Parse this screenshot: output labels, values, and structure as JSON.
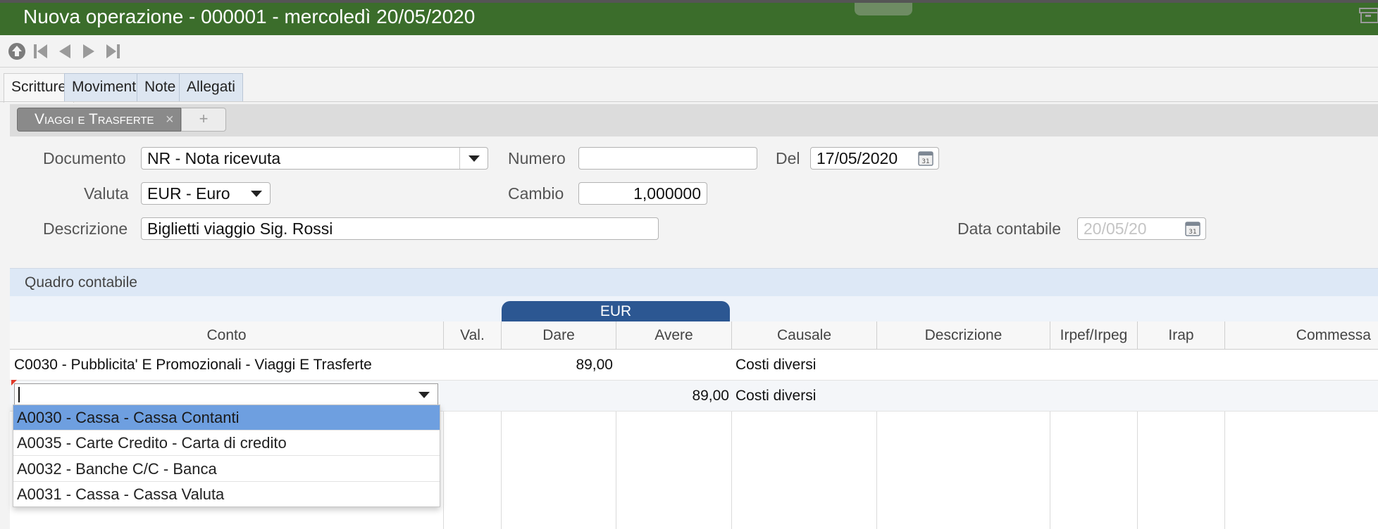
{
  "window": {
    "title": "Nuova operazione - 000001 - mercoledì 20/05/2020"
  },
  "toolbar": {
    "buttons": [
      "upload-icon",
      "first-record-icon",
      "previous-record-icon",
      "next-record-icon",
      "last-record-icon"
    ],
    "right_icon": "archive-icon"
  },
  "tabs": [
    {
      "label": "Scritture",
      "active": true
    },
    {
      "label": "Movimenti",
      "active": false
    },
    {
      "label": "Note",
      "active": false
    },
    {
      "label": "Allegati",
      "active": false
    }
  ],
  "subtabs": {
    "active_label": "Viaggi e Trasferte",
    "close_glyph": "×",
    "add_glyph": "+"
  },
  "form": {
    "documento": {
      "label": "Documento",
      "value": "NR - Nota ricevuta"
    },
    "numero": {
      "label": "Numero",
      "value": ""
    },
    "del": {
      "label": "Del",
      "value": "17/05/2020"
    },
    "valuta": {
      "label": "Valuta",
      "value": "EUR - Euro"
    },
    "cambio": {
      "label": "Cambio",
      "value": "1,000000"
    },
    "descrizione": {
      "label": "Descrizione",
      "value": "Biglietti viaggio Sig. Rossi"
    },
    "data_contabile": {
      "label": "Data contabile",
      "placeholder": "20/05/20"
    }
  },
  "quadro": {
    "title": "Quadro contabile",
    "currency_group": "EUR",
    "columns": [
      "Conto",
      "Val.",
      "Dare",
      "Avere",
      "Causale",
      "Descrizione",
      "Irpef/Irpeg",
      "Irap",
      "Commessa"
    ],
    "rows": [
      {
        "conto": "C0030 - Pubblicita' E Promozionali - Viaggi E Trasferte",
        "val": "",
        "dare": "89,00",
        "avere": "",
        "causale": "Costi diversi"
      },
      {
        "conto": "",
        "val": "",
        "dare": "",
        "avere": "89,00",
        "causale": "Costi diversi"
      }
    ],
    "dropdown_options": [
      "A0030 - Cassa - Cassa Contanti",
      "A0035 - Carte Credito - Carta di credito",
      "A0032 - Banche C/C - Banca",
      "A0031 - Cassa - Cassa Valuta"
    ],
    "selected_option_index": 0
  },
  "colors": {
    "titlebar": "#3b6d2b",
    "eur_badge": "#2c5792",
    "dropdown_highlight": "#6e9fe0"
  }
}
